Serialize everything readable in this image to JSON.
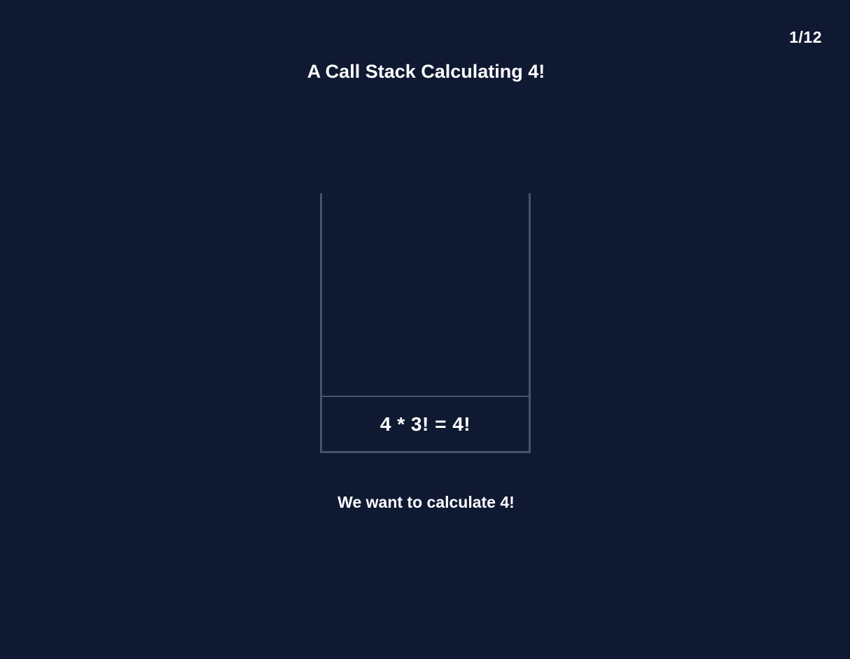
{
  "header": {
    "slide_counter": "1/12",
    "title": "A Call Stack Calculating 4!"
  },
  "stack": {
    "frames": [
      {
        "label": "4 * 3! = 4!"
      }
    ]
  },
  "caption": "We want to calculate 4!",
  "colors": {
    "background": "#0f1932",
    "stack_border": "#4a5468",
    "text": "#ffffff"
  }
}
